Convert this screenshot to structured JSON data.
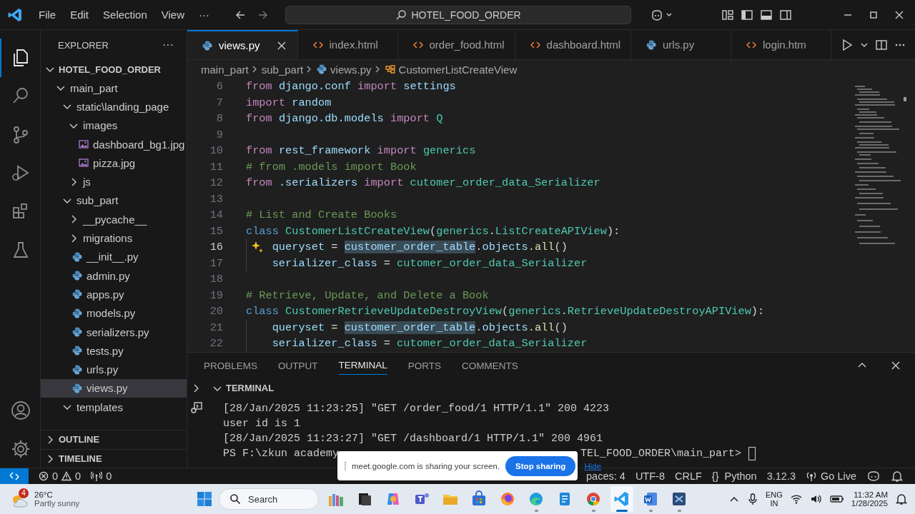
{
  "title_bar": {
    "menus": [
      "File",
      "Edit",
      "Selection",
      "View",
      "···"
    ],
    "command_center": "HOTEL_FOOD_ORDER"
  },
  "activity_bar": [
    {
      "kind": "explorer",
      "selected": true
    },
    {
      "kind": "search",
      "selected": false
    },
    {
      "kind": "source-control",
      "selected": false
    },
    {
      "kind": "run-debug",
      "selected": false
    },
    {
      "kind": "extensions",
      "selected": false
    },
    {
      "kind": "testing",
      "selected": false
    }
  ],
  "sidebar": {
    "title": "EXPLORER",
    "more": "···",
    "root": {
      "label": "HOTEL_FOOD_ORDER",
      "expanded": true
    },
    "tree": [
      {
        "label": "main_part",
        "kind": "folder",
        "expanded": true,
        "selected": false,
        "children": [
          {
            "label": "static\\landing_page",
            "kind": "folder",
            "expanded": true,
            "selected": false,
            "children": [
              {
                "label": "images",
                "kind": "folder",
                "expanded": true,
                "selected": false,
                "children": [
                  {
                    "label": "dashboard_bg1.jpg",
                    "kind": "image",
                    "selected": false
                  },
                  {
                    "label": "pizza.jpg",
                    "kind": "image",
                    "selected": false
                  }
                ]
              },
              {
                "label": "js",
                "kind": "folder",
                "expanded": false,
                "selected": false
              }
            ]
          },
          {
            "label": "sub_part",
            "kind": "folder",
            "expanded": true,
            "selected": false,
            "children": [
              {
                "label": "__pycache__",
                "kind": "folder",
                "expanded": false,
                "selected": false
              },
              {
                "label": "migrations",
                "kind": "folder",
                "expanded": false,
                "selected": false
              },
              {
                "label": "__init__.py",
                "kind": "python",
                "selected": false
              },
              {
                "label": "admin.py",
                "kind": "python",
                "selected": false
              },
              {
                "label": "apps.py",
                "kind": "python",
                "selected": false
              },
              {
                "label": "models.py",
                "kind": "python",
                "selected": false
              },
              {
                "label": "serializers.py",
                "kind": "python",
                "selected": false
              },
              {
                "label": "tests.py",
                "kind": "python",
                "selected": false
              },
              {
                "label": "urls.py",
                "kind": "python",
                "selected": false
              },
              {
                "label": "views.py",
                "kind": "python",
                "selected": true
              }
            ]
          },
          {
            "label": "templates",
            "kind": "folder",
            "expanded": true,
            "selected": false
          }
        ]
      }
    ],
    "sections": [
      {
        "label": "OUTLINE",
        "expanded": false
      },
      {
        "label": "TIMELINE",
        "expanded": false
      }
    ]
  },
  "tabs": [
    {
      "label": "views.py",
      "kind": "python",
      "selected": true
    },
    {
      "label": "index.html",
      "kind": "html",
      "selected": false
    },
    {
      "label": "order_food.html",
      "kind": "html",
      "selected": false
    },
    {
      "label": "dashboard.html",
      "kind": "html",
      "selected": false
    },
    {
      "label": "urls.py",
      "kind": "python",
      "selected": false
    },
    {
      "label": "login.htm",
      "kind": "html",
      "selected": false
    }
  ],
  "breadcrumb": [
    {
      "label": "main_part",
      "kind": "folder"
    },
    {
      "label": "sub_part",
      "kind": "folder"
    },
    {
      "label": "views.py",
      "kind": "python"
    },
    {
      "label": "CustomerListCreateView",
      "kind": "class"
    }
  ],
  "code": [
    {
      "number": "6",
      "current": false,
      "indented": false,
      "hint": false,
      "tokens": [
        {
          "kind": "kw",
          "text": "from "
        },
        {
          "kind": "mod",
          "text": "django.conf "
        },
        {
          "kind": "kw",
          "text": "import "
        },
        {
          "kind": "mod",
          "text": "settings"
        }
      ]
    },
    {
      "number": "7",
      "current": false,
      "indented": false,
      "hint": false,
      "tokens": [
        {
          "kind": "kw",
          "text": "import "
        },
        {
          "kind": "mod",
          "text": "random"
        }
      ]
    },
    {
      "number": "8",
      "current": false,
      "indented": false,
      "hint": false,
      "tokens": [
        {
          "kind": "kw",
          "text": "from "
        },
        {
          "kind": "mod",
          "text": "django.db.models "
        },
        {
          "kind": "kw",
          "text": "import "
        },
        {
          "kind": "cls",
          "text": "Q"
        }
      ]
    },
    {
      "number": "9",
      "current": false,
      "indented": false,
      "hint": false
    },
    {
      "number": "10",
      "current": false,
      "indented": false,
      "hint": false,
      "tokens": [
        {
          "kind": "kw",
          "text": "from "
        },
        {
          "kind": "mod",
          "text": "rest_framework "
        },
        {
          "kind": "kw",
          "text": "import "
        },
        {
          "kind": "cls",
          "text": "generics"
        }
      ]
    },
    {
      "number": "11",
      "current": false,
      "indented": false,
      "hint": false,
      "tokens": [
        {
          "kind": "cmt",
          "text": "# from .models import Book"
        }
      ]
    },
    {
      "number": "12",
      "current": false,
      "indented": false,
      "hint": false,
      "tokens": [
        {
          "kind": "kw",
          "text": "from "
        },
        {
          "kind": "mod",
          "text": ".serializers "
        },
        {
          "kind": "kw",
          "text": "import "
        },
        {
          "kind": "cls",
          "text": "cutomer_order_data_Serializer"
        }
      ]
    },
    {
      "number": "13",
      "current": false,
      "indented": false,
      "hint": false
    },
    {
      "number": "14",
      "current": false,
      "indented": false,
      "hint": false,
      "tokens": [
        {
          "kind": "cmt",
          "text": "# List and Create Books"
        }
      ]
    },
    {
      "number": "15",
      "current": false,
      "indented": false,
      "hint": false,
      "tokens": [
        {
          "kind": "def",
          "text": "class "
        },
        {
          "kind": "cls",
          "text": "CustomerListCreateView"
        },
        {
          "kind": "plain",
          "text": "("
        },
        {
          "kind": "cls",
          "text": "generics"
        },
        {
          "kind": "plain",
          "text": "."
        },
        {
          "kind": "cls",
          "text": "ListCreateAPIView"
        },
        {
          "kind": "plain",
          "text": "):"
        }
      ]
    },
    {
      "number": "16",
      "current": true,
      "indented": true,
      "hint": true,
      "tokens": [
        {
          "kind": "var",
          "text": "queryset"
        },
        {
          "kind": "plain",
          "text": " = "
        },
        {
          "kind": "match",
          "text": "customer_order_table"
        },
        {
          "kind": "plain",
          "text": "."
        },
        {
          "kind": "var",
          "text": "objects"
        },
        {
          "kind": "plain",
          "text": "."
        },
        {
          "kind": "fn",
          "text": "all"
        },
        {
          "kind": "plain",
          "text": "()"
        }
      ]
    },
    {
      "number": "17",
      "current": false,
      "indented": true,
      "hint": false,
      "tokens": [
        {
          "kind": "var",
          "text": "serializer_class"
        },
        {
          "kind": "plain",
          "text": " = "
        },
        {
          "kind": "cls",
          "text": "cutomer_order_data_Serializer"
        }
      ]
    },
    {
      "number": "18",
      "current": false,
      "indented": false,
      "hint": false
    },
    {
      "number": "19",
      "current": false,
      "indented": false,
      "hint": false,
      "tokens": [
        {
          "kind": "cmt",
          "text": "# Retrieve, Update, and Delete a Book"
        }
      ]
    },
    {
      "number": "20",
      "current": false,
      "indented": false,
      "hint": false,
      "tokens": [
        {
          "kind": "def",
          "text": "class "
        },
        {
          "kind": "cls",
          "text": "CustomerRetrieveUpdateDestroyView"
        },
        {
          "kind": "plain",
          "text": "("
        },
        {
          "kind": "cls",
          "text": "generics"
        },
        {
          "kind": "plain",
          "text": "."
        },
        {
          "kind": "cls",
          "text": "RetrieveUpdateDestroyAPIView"
        },
        {
          "kind": "plain",
          "text": "):"
        }
      ]
    },
    {
      "number": "21",
      "current": false,
      "indented": true,
      "hint": false,
      "tokens": [
        {
          "kind": "var",
          "text": "queryset"
        },
        {
          "kind": "plain",
          "text": " = "
        },
        {
          "kind": "match",
          "text": "customer_order_table"
        },
        {
          "kind": "plain",
          "text": "."
        },
        {
          "kind": "var",
          "text": "objects"
        },
        {
          "kind": "plain",
          "text": "."
        },
        {
          "kind": "fn",
          "text": "all"
        },
        {
          "kind": "plain",
          "text": "()"
        }
      ]
    },
    {
      "number": "22",
      "current": false,
      "indented": true,
      "hint": false,
      "tokens": [
        {
          "kind": "var",
          "text": "serializer_class"
        },
        {
          "kind": "plain",
          "text": " = "
        },
        {
          "kind": "cls",
          "text": "cutomer_order_data_Serializer"
        }
      ]
    }
  ],
  "panel": {
    "tabs": [
      {
        "label": "PROBLEMS",
        "selected": false
      },
      {
        "label": "OUTPUT",
        "selected": false
      },
      {
        "label": "TERMINAL",
        "selected": true
      },
      {
        "label": "PORTS",
        "selected": false
      },
      {
        "label": "COMMENTS",
        "selected": false
      }
    ],
    "section": "TERMINAL",
    "terminal": [
      "[28/Jan/2025 11:23:25] \"GET /order_food/1 HTTP/1.1\" 200 4223",
      "user id is 1",
      "[28/Jan/2025 11:23:27] \"GET /dashboard/1 HTTP/1.1\" 200 4961"
    ],
    "prompt": {
      "start": "PS F:\\zkun academy",
      "end": "TEL_FOOD_ORDER\\main_part>"
    }
  },
  "share_notice": {
    "text": "meet.google.com is sharing your screen.",
    "stop": "Stop sharing",
    "hide": "Hide"
  },
  "status_bar": {
    "errors": "0",
    "warnings": "0",
    "ports": "0",
    "right": [
      {
        "kind": "text",
        "text": "paces: 4"
      },
      {
        "kind": "text",
        "text": "UTF-8"
      },
      {
        "kind": "text",
        "text": "CRLF"
      },
      {
        "kind": "language",
        "icon": "{}",
        "text": "Python"
      },
      {
        "kind": "text",
        "text": "3.12.3"
      },
      {
        "kind": "live",
        "text": "Go Live"
      }
    ]
  },
  "taskbar": {
    "weather": {
      "badge": "4",
      "temp": "26°C",
      "condition": "Partly sunny"
    },
    "search": "Search",
    "apps": [
      {
        "kind": "widgets",
        "running": false,
        "selected": false
      },
      {
        "kind": "task-view",
        "running": false,
        "selected": false
      },
      {
        "kind": "copilot",
        "running": false,
        "selected": false
      },
      {
        "kind": "teams",
        "running": false,
        "selected": false
      },
      {
        "kind": "folder",
        "running": false,
        "selected": false
      },
      {
        "kind": "store",
        "running": false,
        "selected": false
      },
      {
        "kind": "firefox",
        "running": false,
        "selected": false
      },
      {
        "kind": "edge",
        "running": true,
        "selected": false
      },
      {
        "kind": "notepad",
        "running": false,
        "selected": false
      },
      {
        "kind": "chrome",
        "running": true,
        "selected": false
      },
      {
        "kind": "vscode",
        "running": true,
        "selected": true
      },
      {
        "kind": "word",
        "running": true,
        "selected": false
      },
      {
        "kind": "vs",
        "running": true,
        "selected": false
      }
    ],
    "language": "ENG",
    "region": "IN",
    "time": "11:32 AM",
    "date": "1/28/2025"
  }
}
